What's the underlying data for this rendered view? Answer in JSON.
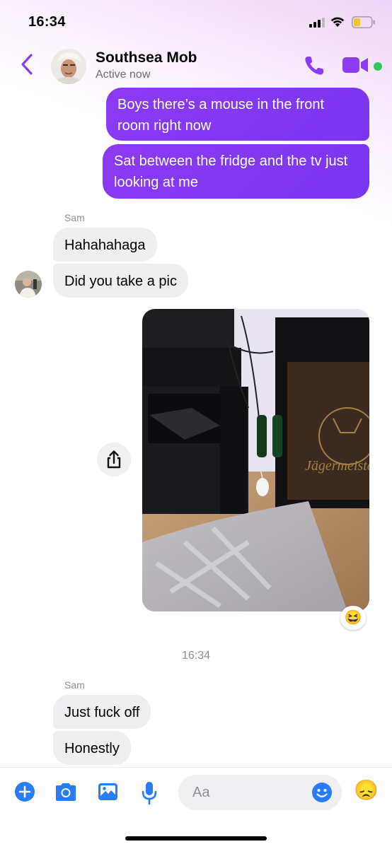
{
  "status_bar": {
    "time": "16:34"
  },
  "header": {
    "title": "Southsea Mob",
    "subtitle": "Active now"
  },
  "messages": {
    "out_1": "Boys there’s a mouse in the front room right now",
    "out_2": "Sat between the fridge and the tv just looking at me",
    "sender_1": "Sam",
    "in_1": "Hahahahaga",
    "in_2": "Did you take a pic",
    "photo_label": "Jägermeister",
    "reaction": "😆",
    "timestamp": "16:34",
    "sender_2": "Sam",
    "in_3": "Just fuck off",
    "in_4": "Honestly"
  },
  "composer": {
    "placeholder": "Aa",
    "emoji_button": "😞"
  },
  "colors": {
    "accent": "#8b3bf2",
    "online": "#34c759",
    "incoming_bubble": "#efeff2",
    "composer_icons": "#2a7bf6"
  },
  "icons": [
    "back-chevron-icon",
    "phone-icon",
    "video-camera-icon",
    "plus-icon",
    "camera-icon",
    "gallery-icon",
    "microphone-icon",
    "smiley-icon",
    "share-icon"
  ]
}
